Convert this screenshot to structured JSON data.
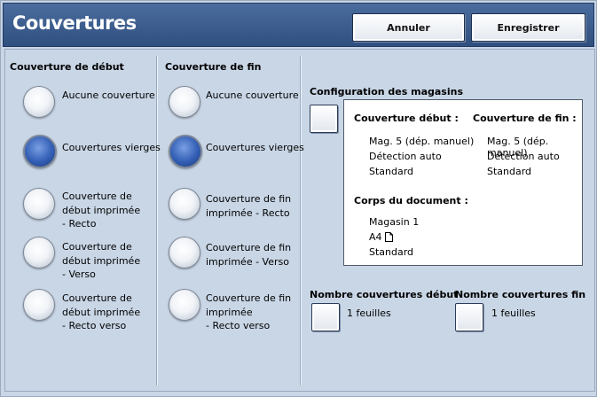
{
  "header": {
    "title": "Couvertures",
    "cancel_label": "Annuler",
    "save_label": "Enregistrer"
  },
  "front_cover": {
    "heading": "Couverture de début",
    "options": [
      {
        "label": "Aucune couverture",
        "selected": false
      },
      {
        "label": "Couvertures vierges",
        "selected": true
      },
      {
        "label": "Couverture de début imprimée - Recto",
        "lines": [
          "Couverture de",
          "début imprimée",
          "- Recto"
        ],
        "selected": false
      },
      {
        "label": "Couverture de début imprimée - Verso",
        "lines": [
          "Couverture de",
          "début imprimée",
          "- Verso"
        ],
        "selected": false
      },
      {
        "label": "Couverture de début imprimée - Recto verso",
        "lines": [
          "Couverture de",
          "début imprimée",
          "- Recto verso"
        ],
        "selected": false
      }
    ]
  },
  "back_cover": {
    "heading": "Couverture de fin",
    "options": [
      {
        "label": "Aucune couverture",
        "selected": false
      },
      {
        "label": "Couvertures vierges",
        "selected": true
      },
      {
        "label": "Couverture de fin imprimée - Recto",
        "lines": [
          "Couverture de fin",
          "imprimée - Recto"
        ],
        "selected": false
      },
      {
        "label": "Couverture de fin imprimée - Verso",
        "lines": [
          "Couverture de fin",
          "imprimée - Verso"
        ],
        "selected": false
      },
      {
        "label": "Couverture de fin imprimée - Recto verso",
        "lines": [
          "Couverture de fin",
          "imprimée",
          "- Recto verso"
        ],
        "selected": false
      }
    ]
  },
  "tray_config": {
    "heading": "Configuration des magasins",
    "front_heading": "Couverture début :",
    "front_tray": "Mag. 5 (dép. manuel)",
    "front_detect": "Détection auto",
    "front_type": "Standard",
    "back_heading": "Couverture de fin :",
    "back_tray": "Mag. 5 (dép. manuel)",
    "back_detect": "Détection auto",
    "back_type": "Standard",
    "body_heading": "Corps du document :",
    "body_tray": "Magasin 1",
    "body_size": "A4",
    "body_orientation_icon": "portrait-page-icon",
    "body_type": "Standard"
  },
  "counts": {
    "front_heading": "Nombre couvertures début",
    "front_value": "1 feuilles",
    "back_heading": "Nombre couvertures fin",
    "back_value": "1 feuilles"
  },
  "colors": {
    "header_bg": "#3b5c8c",
    "panel_bg": "#c9d6e6",
    "radio_selected": "#335fb5"
  }
}
